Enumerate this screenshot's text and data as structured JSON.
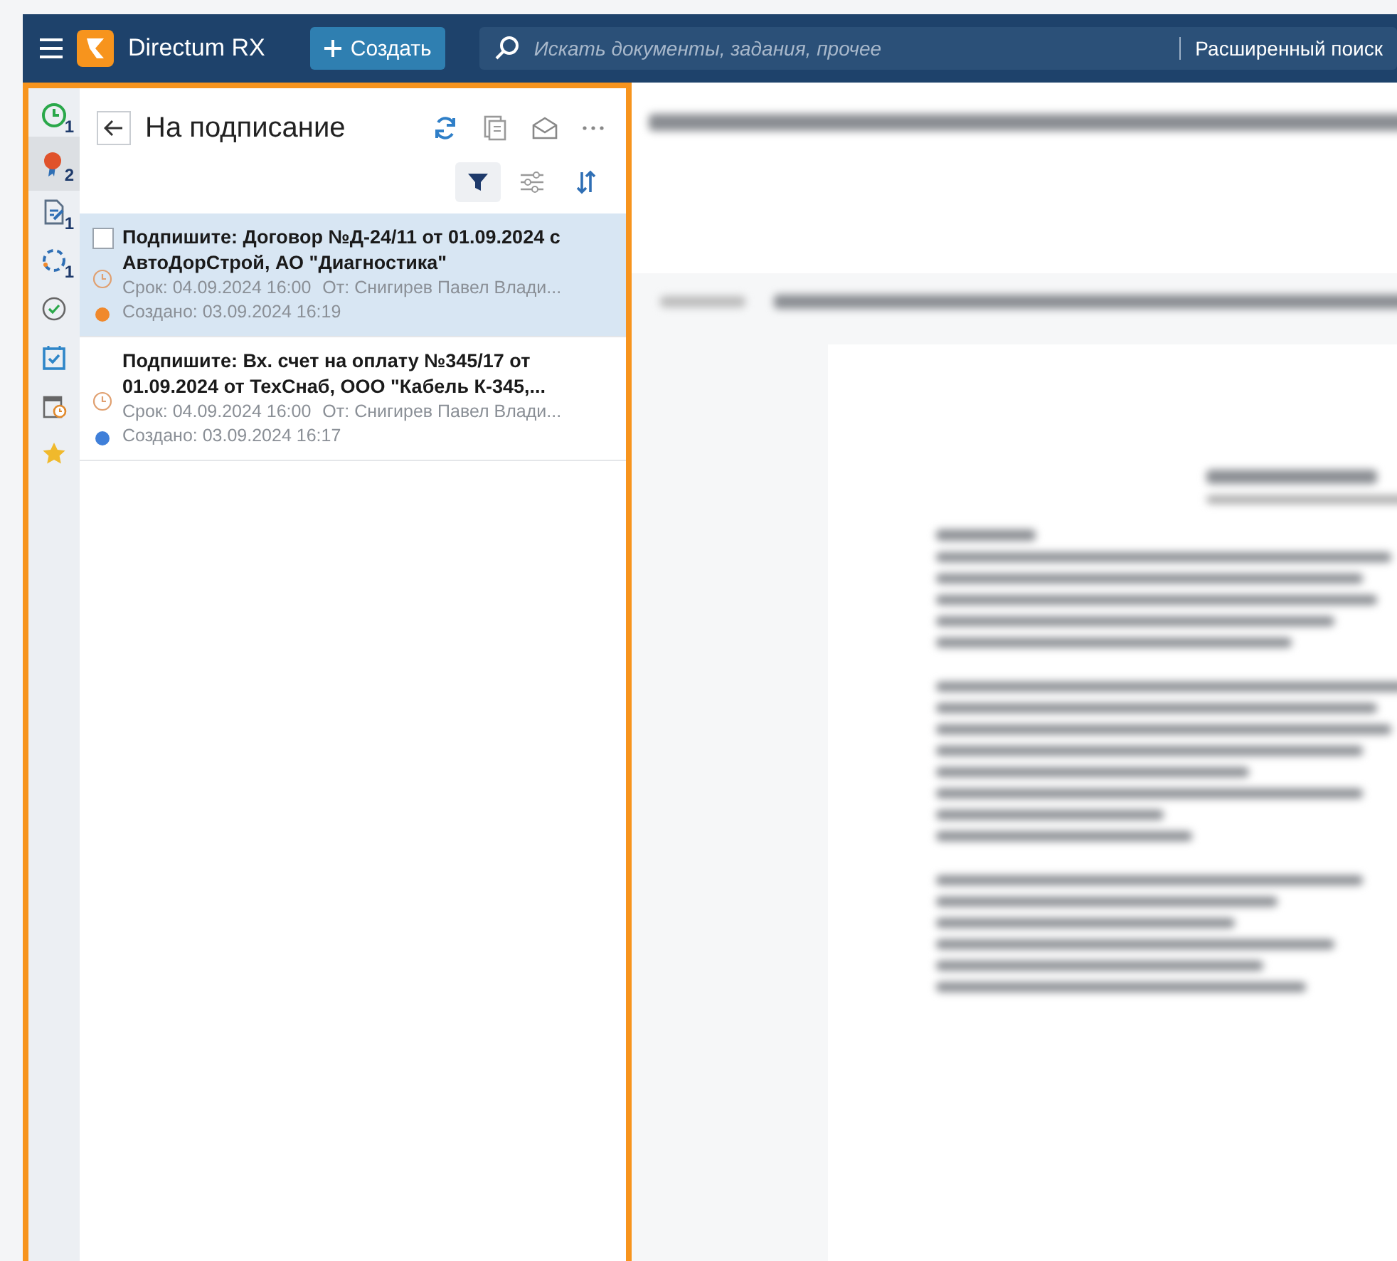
{
  "header": {
    "app_name": "Directum RX",
    "create_button": "Создать",
    "search": {
      "placeholder": "Искать документы, задания, прочее"
    },
    "advanced_search": "Расширенный поиск"
  },
  "sidebar": {
    "items": [
      {
        "kind": "clock",
        "badge": "1",
        "selected": false
      },
      {
        "kind": "award",
        "badge": "2",
        "selected": true
      },
      {
        "kind": "document",
        "badge": "1",
        "selected": false
      },
      {
        "kind": "cycle",
        "badge": "1",
        "selected": false
      },
      {
        "kind": "check",
        "selected": false
      },
      {
        "kind": "task",
        "selected": false
      },
      {
        "kind": "calendar",
        "selected": false
      },
      {
        "kind": "star",
        "selected": false
      }
    ]
  },
  "list": {
    "title": "На подписание",
    "filter_active": true,
    "items": [
      {
        "title": "Подпишите: Договор №Д-24/11 от 01.09.2024 с АвтоДорСтрой, АО \"Диагностика\"",
        "due": "Срок: 04.09.2024 16:00",
        "from": "От: Снигирев Павел Влади...",
        "created": "Создано: 03.09.2024 16:19",
        "color": "#f0892c",
        "selected": true
      },
      {
        "title": "Подпишите: Вх. счет на оплату №345/17 от 01.09.2024 от ТехСнаб, ООО \"Кабель К-345,...",
        "due": "Срок: 04.09.2024 16:00",
        "from": "От: Снигирев Павел Влади...",
        "created": "Создано: 03.09.2024 16:17",
        "color": "#3f7fd9",
        "selected": false
      }
    ]
  }
}
